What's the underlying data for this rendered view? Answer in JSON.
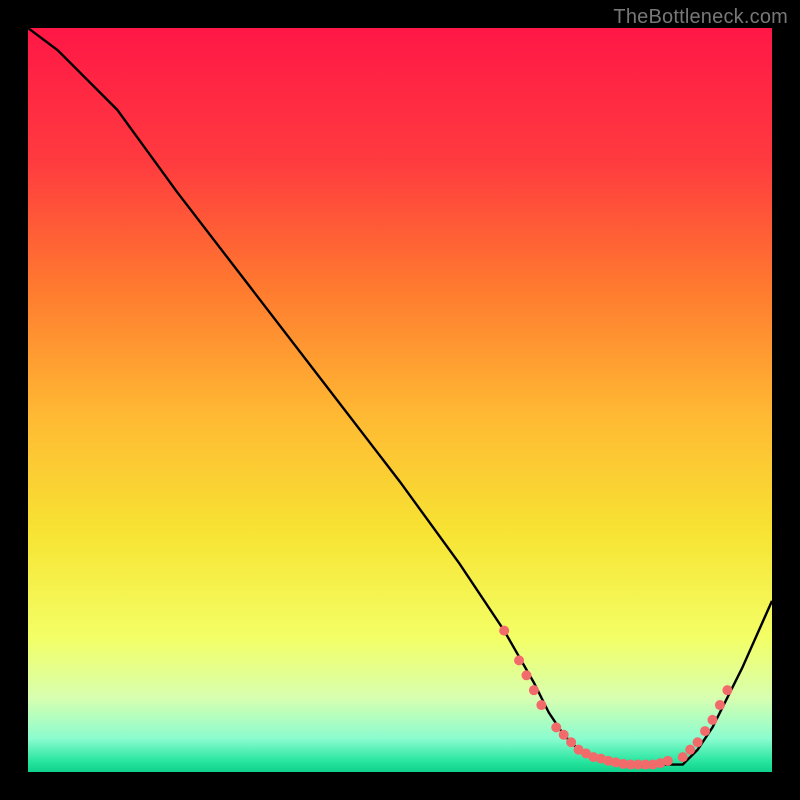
{
  "attribution": "TheBottleneck.com",
  "chart_data": {
    "type": "line",
    "title": "",
    "xlabel": "",
    "ylabel": "",
    "xlim": [
      0,
      100
    ],
    "ylim": [
      0,
      100
    ],
    "grid": false,
    "legend": false,
    "background_gradient": {
      "stops": [
        {
          "offset": 0.0,
          "color": "#ff1746"
        },
        {
          "offset": 0.18,
          "color": "#ff3b3f"
        },
        {
          "offset": 0.35,
          "color": "#ff7a2f"
        },
        {
          "offset": 0.52,
          "color": "#ffb933"
        },
        {
          "offset": 0.68,
          "color": "#f7e433"
        },
        {
          "offset": 0.82,
          "color": "#f3ff66"
        },
        {
          "offset": 0.9,
          "color": "#d8ffb0"
        },
        {
          "offset": 0.955,
          "color": "#8bfccf"
        },
        {
          "offset": 0.985,
          "color": "#29e6a0"
        },
        {
          "offset": 1.0,
          "color": "#0fd18b"
        }
      ]
    },
    "series": [
      {
        "name": "bottleneck-curve",
        "color": "#000000",
        "x": [
          0,
          4,
          8,
          12,
          20,
          30,
          40,
          50,
          58,
          64,
          68,
          70,
          72,
          74,
          76,
          80,
          84,
          88,
          90,
          92,
          96,
          100
        ],
        "y": [
          100,
          97,
          93,
          89,
          78,
          65,
          52,
          39,
          28,
          19,
          12,
          8,
          5,
          3,
          2,
          1,
          1,
          1,
          3,
          6,
          14,
          23
        ]
      }
    ],
    "markers": {
      "name": "highlight-dots",
      "color": "#f26b6b",
      "radius": 5,
      "points": [
        {
          "x": 64,
          "y": 19
        },
        {
          "x": 66,
          "y": 15
        },
        {
          "x": 67,
          "y": 13
        },
        {
          "x": 68,
          "y": 11
        },
        {
          "x": 69,
          "y": 9
        },
        {
          "x": 71,
          "y": 6
        },
        {
          "x": 72,
          "y": 5
        },
        {
          "x": 73,
          "y": 4
        },
        {
          "x": 74,
          "y": 3
        },
        {
          "x": 75,
          "y": 2.5
        },
        {
          "x": 76,
          "y": 2
        },
        {
          "x": 77,
          "y": 1.8
        },
        {
          "x": 78,
          "y": 1.5
        },
        {
          "x": 79,
          "y": 1.3
        },
        {
          "x": 80,
          "y": 1.1
        },
        {
          "x": 81,
          "y": 1
        },
        {
          "x": 82,
          "y": 1
        },
        {
          "x": 83,
          "y": 1
        },
        {
          "x": 84,
          "y": 1
        },
        {
          "x": 85,
          "y": 1.2
        },
        {
          "x": 86,
          "y": 1.5
        },
        {
          "x": 88,
          "y": 2
        },
        {
          "x": 89,
          "y": 3
        },
        {
          "x": 90,
          "y": 4
        },
        {
          "x": 91,
          "y": 5.5
        },
        {
          "x": 92,
          "y": 7
        },
        {
          "x": 93,
          "y": 9
        },
        {
          "x": 94,
          "y": 11
        }
      ]
    }
  }
}
